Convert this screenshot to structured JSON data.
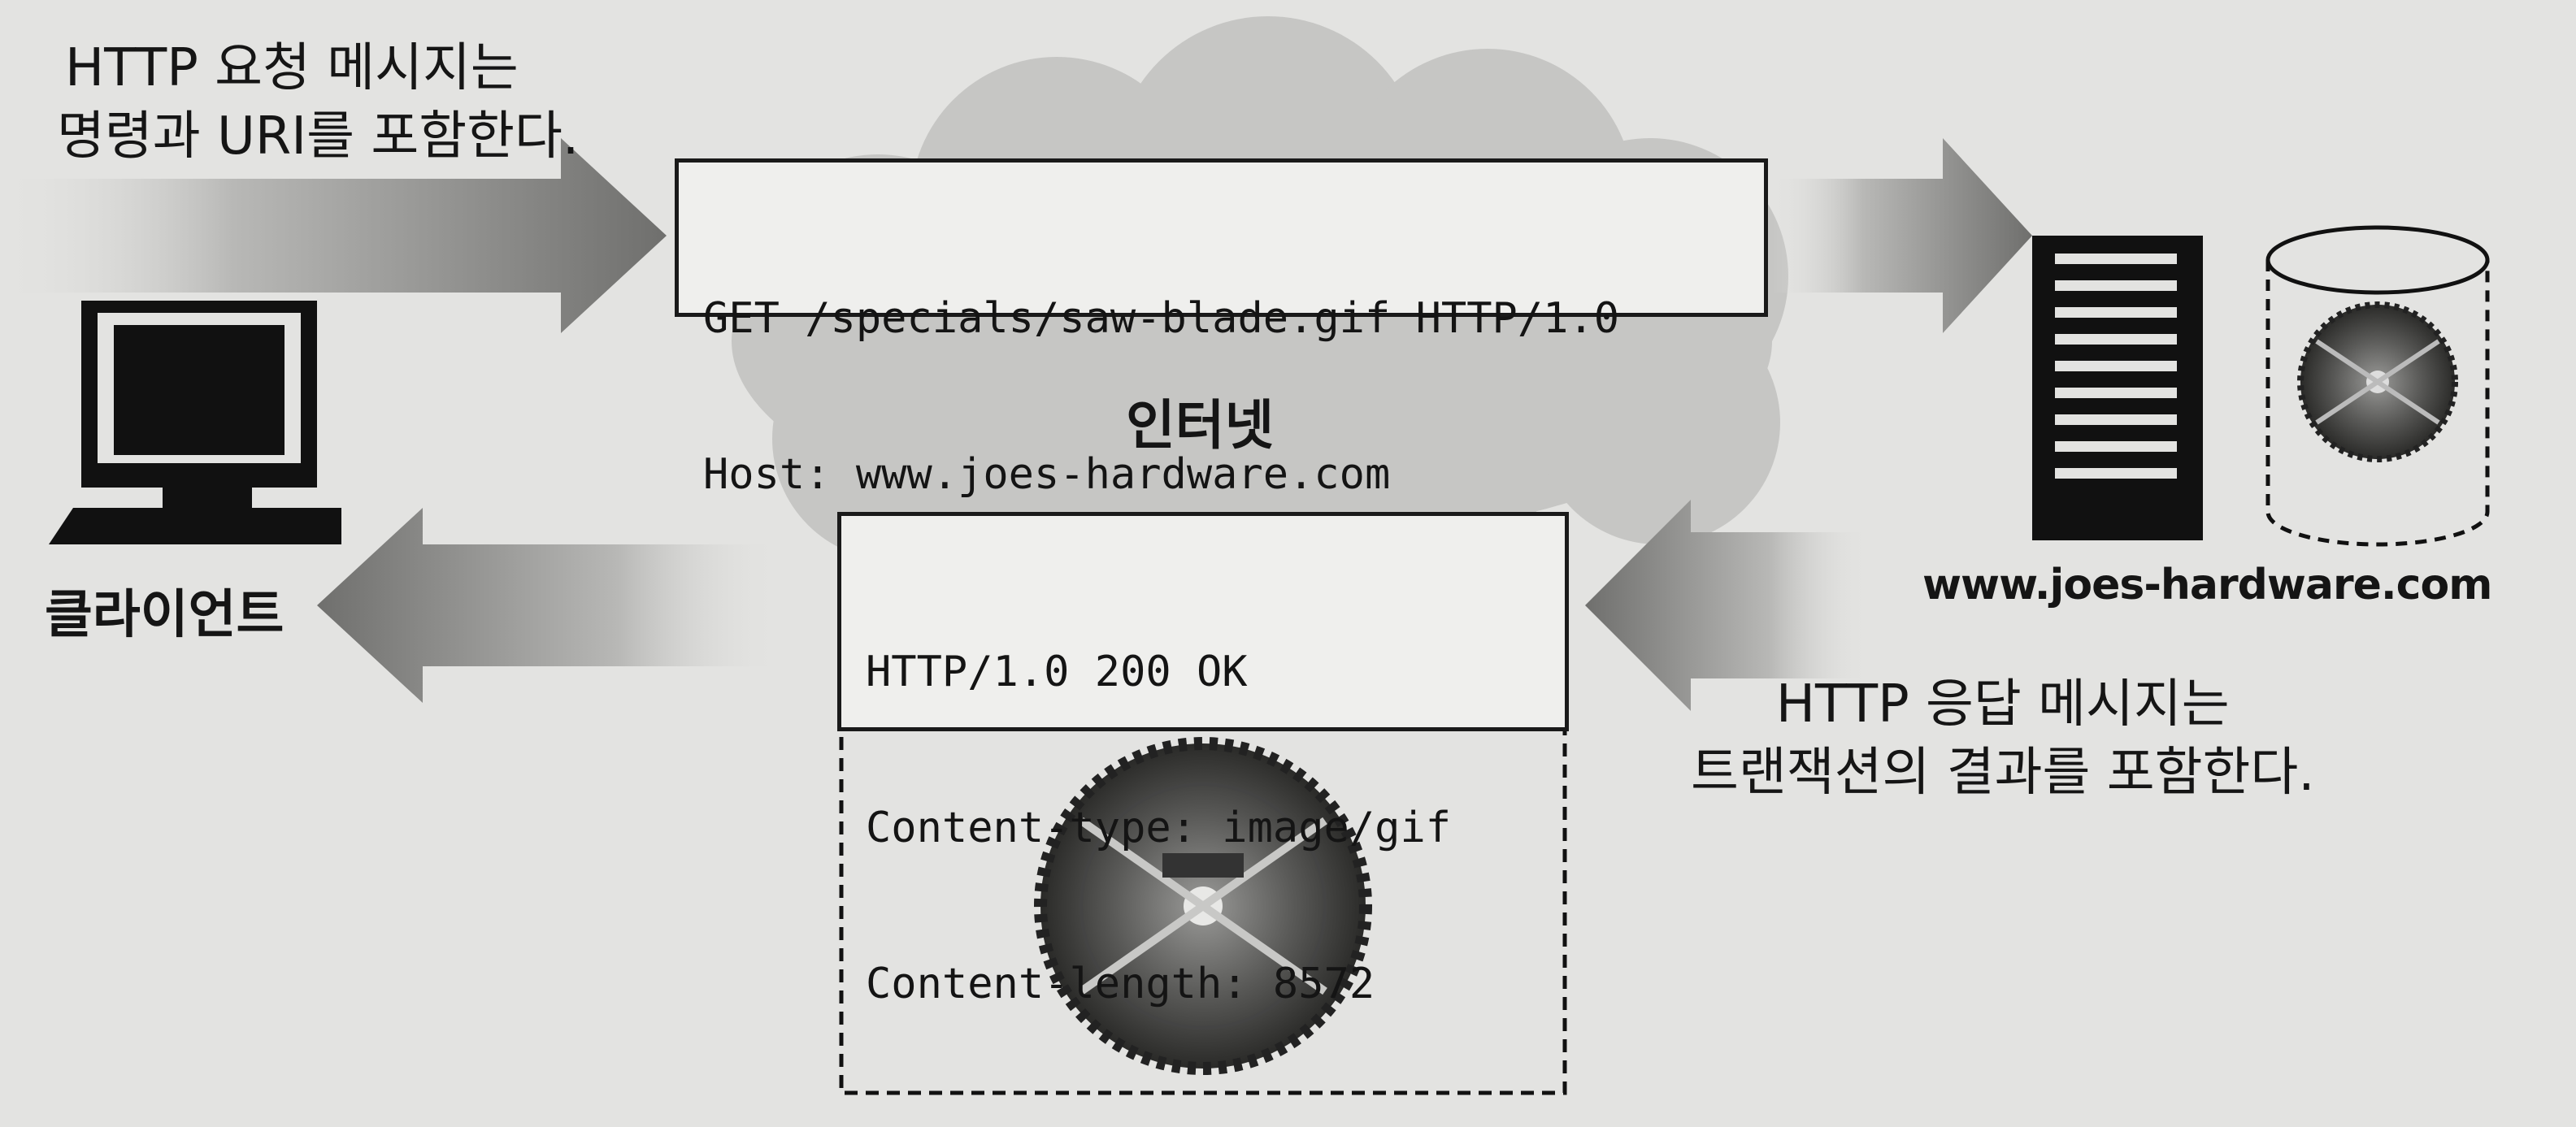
{
  "request_caption": {
    "line1": "HTTP 요청 메시지는",
    "line2": "명령과 URI를 포함한다."
  },
  "request_message": {
    "lines": [
      "GET /specials/saw-blade.gif HTTP/1.0",
      "Host: www.joes-hardware.com"
    ]
  },
  "internet_label": "인터넷",
  "client_label": "클라이언트",
  "server_label": "www.joes-hardware.com",
  "response_message": {
    "lines": [
      "HTTP/1.0 200 OK",
      "Content-type: image/gif",
      "Content-length: 8572"
    ]
  },
  "response_caption": {
    "line1": "HTTP 응답 메시지는",
    "line2": "트랜잭션의 결과를 포함한다."
  },
  "colors": {
    "background": "#e3e3e1",
    "cloud": "#c6c6c4",
    "arrow": "#8e8e8c",
    "ink": "#151515"
  },
  "icons": [
    "computer-icon",
    "server-icon",
    "database-icon",
    "saw-blade-icon"
  ]
}
